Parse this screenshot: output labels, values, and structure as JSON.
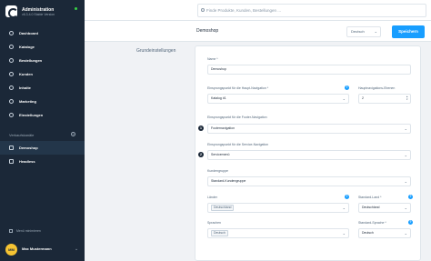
{
  "app": {
    "name": "Administration",
    "version": "v6.3.4.0 Stable Version"
  },
  "sidebar": {
    "items": [
      {
        "icon": "dashboard-icon",
        "label": "Dashboard"
      },
      {
        "icon": "catalog-icon",
        "label": "Kataloge"
      },
      {
        "icon": "orders-icon",
        "label": "Bestellungen"
      },
      {
        "icon": "customers-icon",
        "label": "Kunden"
      },
      {
        "icon": "content-icon",
        "label": "Inhalte"
      },
      {
        "icon": "marketing-icon",
        "label": "Marketing"
      },
      {
        "icon": "settings-icon",
        "label": "Einstellungen"
      }
    ],
    "channels_title": "Verkaufskanäle",
    "channels": [
      {
        "icon": "storefront-icon",
        "label": "Demoshop",
        "active": true
      },
      {
        "icon": "headless-icon",
        "label": "Headless",
        "active": false
      }
    ],
    "collapse_label": "Menü minimieren",
    "user": {
      "initials": "MM",
      "name": "Max Mustermann"
    }
  },
  "header": {
    "search_placeholder": "Finde Produkte, Kunden, Bestellungen ..."
  },
  "subheader": {
    "title": "Demoshop",
    "language": "Deutsch",
    "save_label": "Speichern"
  },
  "main": {
    "section_title": "Grundeinstellungen",
    "fields": {
      "name": {
        "label": "Name *",
        "value": "Demoshop"
      },
      "main_nav": {
        "label": "Einsprungspunkt für die Haupt-Navigation *",
        "value": "Katalog #1"
      },
      "nav_levels": {
        "label": "Hauptnavigations-Ebenen",
        "value": "2"
      },
      "footer_nav": {
        "label": "Einsprungspunkt für die Footer-Navigation",
        "value": "Footernavigation"
      },
      "service_nav": {
        "label": "Einsprungspunkt für die Service-Navigation",
        "value": "Servicemenü"
      },
      "customer_group": {
        "label": "Kundengruppe",
        "value": "Standard-Kundengruppe"
      },
      "countries": {
        "label": "Länder",
        "value": "Deutschland"
      },
      "default_country": {
        "label": "Standard-Land *",
        "value": "Deutschland"
      },
      "languages": {
        "label": "Sprachen",
        "value": "Deutsch"
      },
      "default_language": {
        "label": "Standard-Sprache *",
        "value": "Deutsch"
      }
    },
    "markers": [
      "1",
      "2"
    ]
  },
  "colors": {
    "sidebar": "#1b2838",
    "accent": "#189eff",
    "avatar": "#f6c433",
    "status": "#37d046"
  }
}
